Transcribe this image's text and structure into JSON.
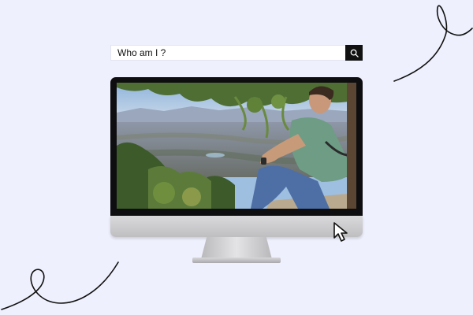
{
  "search": {
    "query": "Who am I ?",
    "button_icon": "search-icon"
  },
  "monitor": {
    "screen_image": "man-sitting-overlooking-valley-photo"
  },
  "decorations": {
    "top_right": "swirl-doodle",
    "bottom_left": "swirl-doodle",
    "pointer": "mouse-cursor-icon"
  },
  "colors": {
    "background": "#eef0fd",
    "search_button": "#111111",
    "bezel": "#0e0e10"
  }
}
